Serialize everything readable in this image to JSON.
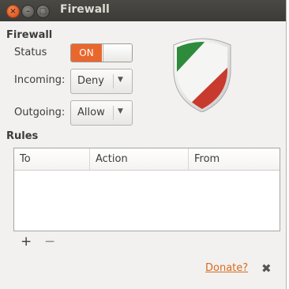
{
  "window": {
    "title": "Firewall"
  },
  "firewall": {
    "section_title": "Firewall",
    "status_label": "Status",
    "status_toggle": "ON",
    "incoming_label": "Incoming:",
    "incoming_value": "Deny",
    "outgoing_label": "Outgoing:",
    "outgoing_value": "Allow"
  },
  "rules": {
    "section_title": "Rules",
    "columns": [
      "To",
      "Action",
      "From"
    ],
    "add_label": "+",
    "remove_label": "−"
  },
  "footer": {
    "donate": "Donate?",
    "close_label": "✖"
  },
  "colors": {
    "accent": "#e9672d",
    "shield_green": "#2e8b3c",
    "shield_red": "#c93a2e"
  }
}
